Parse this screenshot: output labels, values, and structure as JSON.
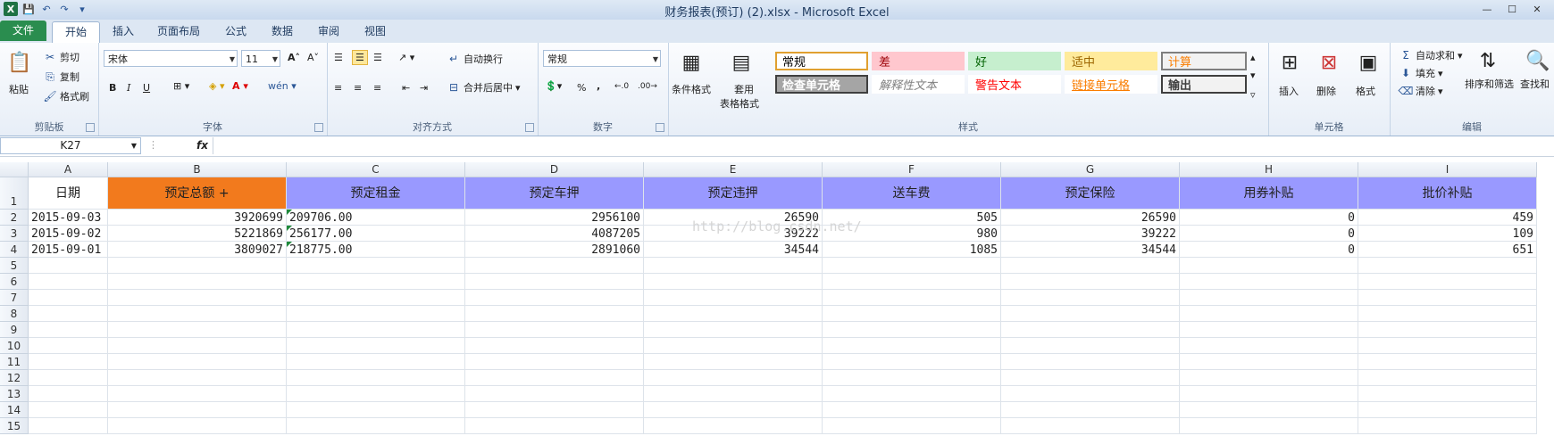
{
  "window": {
    "title": "财务报表(预订) (2).xlsx - Microsoft Excel"
  },
  "tabs": [
    {
      "label": "文件"
    },
    {
      "label": "开始"
    },
    {
      "label": "插入"
    },
    {
      "label": "页面布局"
    },
    {
      "label": "公式"
    },
    {
      "label": "数据"
    },
    {
      "label": "审阅"
    },
    {
      "label": "视图"
    }
  ],
  "ribbon": {
    "clipboard": {
      "paste": "粘贴",
      "cut": "剪切",
      "copy": "复制",
      "painter": "格式刷",
      "label": "剪贴板"
    },
    "font": {
      "name": "宋体",
      "size": "11",
      "bold": "B",
      "italic": "I",
      "underline": "U",
      "label": "字体"
    },
    "align": {
      "wrap": "自动换行",
      "merge": "合并后居中",
      "label": "对齐方式"
    },
    "number": {
      "format": "常规",
      "percent": "%",
      "comma": ",",
      "label": "数字"
    },
    "styles": {
      "cond": "条件格式",
      "table_line1": "套用",
      "table_line2": "表格格式",
      "cells": [
        {
          "text": "常规",
          "bg": "#ffffff",
          "color": "#000000",
          "border": "#e0a030"
        },
        {
          "text": "差",
          "bg": "#ffc7ce",
          "color": "#9c0006",
          "border": "#ffc7ce"
        },
        {
          "text": "好",
          "bg": "#c6efce",
          "color": "#006100",
          "border": "#c6efce"
        },
        {
          "text": "适中",
          "bg": "#ffeb9c",
          "color": "#9c6500",
          "border": "#ffeb9c"
        },
        {
          "text": "计算",
          "bg": "#f2f2f2",
          "color": "#fa7d00",
          "border": "#7f7f7f"
        },
        {
          "text": "检查单元格",
          "bg": "#a5a5a5",
          "color": "#ffffff",
          "border": "#3f3f3f"
        },
        {
          "text": "解释性文本",
          "bg": "#ffffff",
          "color": "#7f7f7f",
          "border": "#ffffff"
        },
        {
          "text": "警告文本",
          "bg": "#ffffff",
          "color": "#ff0000",
          "border": "#ffffff"
        },
        {
          "text": "链接单元格",
          "bg": "#ffffff",
          "color": "#fa7d00",
          "border": "#ffffff"
        },
        {
          "text": "输出",
          "bg": "#f2f2f2",
          "color": "#3f3f3f",
          "border": "#3f3f3f"
        }
      ],
      "label": "样式"
    },
    "cells": {
      "insert": "插入",
      "delete": "删除",
      "format": "格式",
      "label": "单元格"
    },
    "editing": {
      "autosum": "自动求和",
      "fill": "填充",
      "clear": "清除",
      "sort": "排序和筛选",
      "find": "查找和",
      "label": "编辑"
    }
  },
  "formula": {
    "name_box": "K27",
    "fx": "fx",
    "value": ""
  },
  "columns": [
    "A",
    "B",
    "C",
    "D",
    "E",
    "F",
    "G",
    "H",
    "I"
  ],
  "headers": [
    "日期",
    "预定总额 +",
    "预定租金",
    "预定车押",
    "预定违押",
    "送车费",
    "预定保险",
    "用券补贴",
    "批价补贴"
  ],
  "rows": [
    [
      "2015-09-03",
      "3920699",
      "209706.00",
      "2956100",
      "26590",
      "505",
      "26590",
      "0",
      "459"
    ],
    [
      "2015-09-02",
      "5221869",
      "256177.00",
      "4087205",
      "39222",
      "980",
      "39222",
      "0",
      "109"
    ],
    [
      "2015-09-01",
      "3809027",
      "218775.00",
      "2891060",
      "34544",
      "1085",
      "34544",
      "0",
      "651"
    ]
  ],
  "row_numbers": [
    "1",
    "2",
    "3",
    "4",
    "5",
    "6",
    "7",
    "8",
    "9",
    "10",
    "11",
    "12",
    "13",
    "14",
    "15"
  ],
  "watermark": "http://blog.csdn.net/",
  "colors": {
    "header_orange": "#f27a1d",
    "header_purple": "#9999ff",
    "file_tab": "#2a8d4f"
  }
}
